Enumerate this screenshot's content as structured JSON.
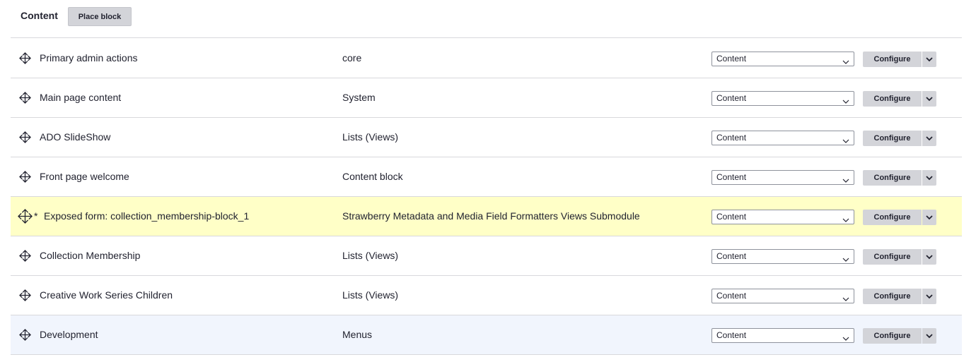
{
  "region": {
    "title": "Content",
    "place_block_label": "Place block"
  },
  "rows": [
    {
      "label": "Primary admin actions",
      "category": "core",
      "region": "Content",
      "configure": "Configure",
      "changed": false,
      "highlight": "none"
    },
    {
      "label": "Main page content",
      "category": "System",
      "region": "Content",
      "configure": "Configure",
      "changed": false,
      "highlight": "none"
    },
    {
      "label": "ADO SlideShow",
      "category": "Lists (Views)",
      "region": "Content",
      "configure": "Configure",
      "changed": false,
      "highlight": "none"
    },
    {
      "label": "Front page welcome",
      "category": "Content block",
      "region": "Content",
      "configure": "Configure",
      "changed": false,
      "highlight": "none"
    },
    {
      "label": "Exposed form: collection_membership-block_1",
      "category": "Strawberry Metadata and Media Field Formatters Views Submodule",
      "region": "Content",
      "configure": "Configure",
      "changed": true,
      "changed_marker": "*",
      "highlight": "changed"
    },
    {
      "label": "Collection Membership",
      "category": "Lists (Views)",
      "region": "Content",
      "configure": "Configure",
      "changed": false,
      "highlight": "none"
    },
    {
      "label": "Creative Work Series Children",
      "category": "Lists (Views)",
      "region": "Content",
      "configure": "Configure",
      "changed": false,
      "highlight": "none"
    },
    {
      "label": "Development",
      "category": "Menus",
      "region": "Content",
      "configure": "Configure",
      "changed": false,
      "highlight": "hover"
    }
  ],
  "icons": {
    "drag_handle": "drag-handle-icon",
    "select_chevron": "chevron-down-icon",
    "dropbutton_toggle": "chevron-down-icon"
  },
  "colors": {
    "changed_row": "#ffffc7",
    "hover_row": "#f1f5fd",
    "button_bg": "#d3d4d9",
    "border": "#d8d8dc",
    "text": "#222330"
  }
}
